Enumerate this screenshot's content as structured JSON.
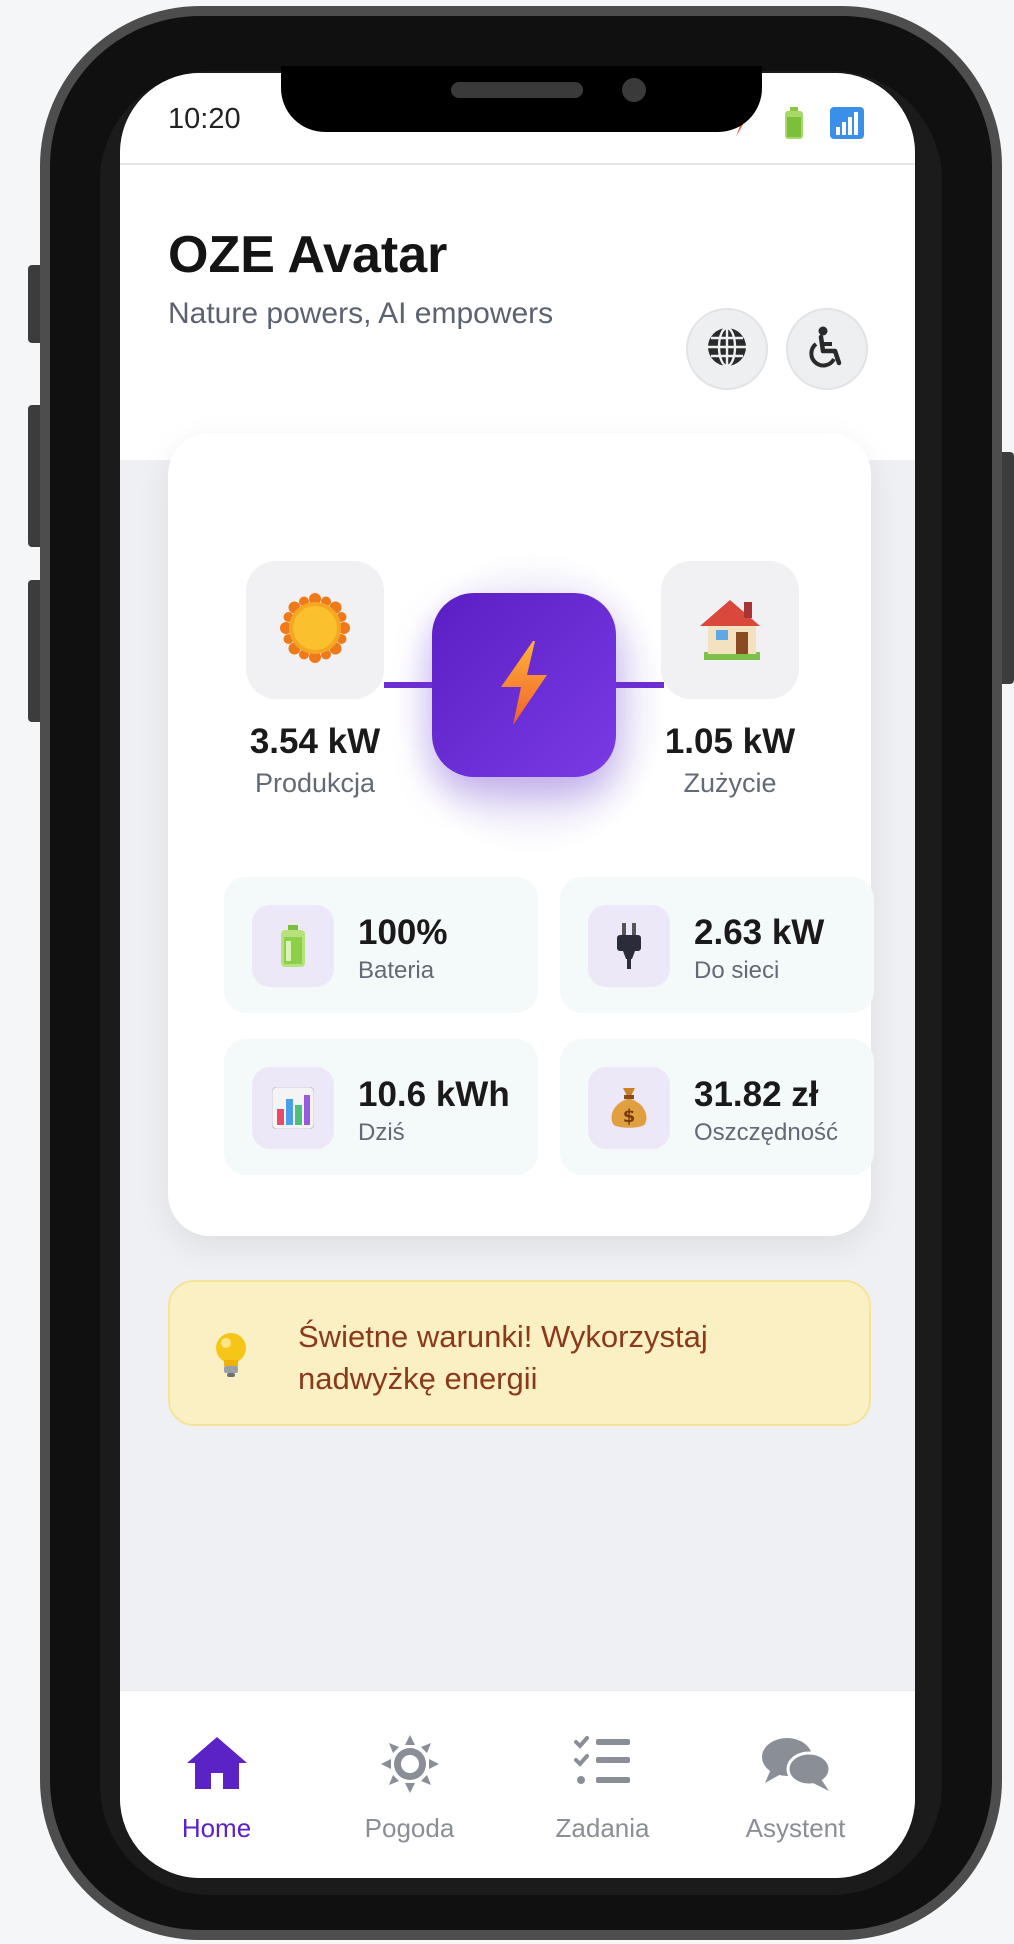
{
  "status_bar": {
    "time": "10:20"
  },
  "header": {
    "title": "OZE Avatar",
    "subtitle": "Nature powers, AI empowers"
  },
  "energy": {
    "production": {
      "value": "3.54 kW",
      "label": "Produkcja"
    },
    "consumption": {
      "value": "1.05 kW",
      "label": "Zużycie"
    },
    "stats": [
      {
        "value": "100%",
        "label": "Bateria",
        "icon": "battery-icon"
      },
      {
        "value": "2.63 kW",
        "label": "Do sieci",
        "icon": "plug-icon"
      },
      {
        "value": "10.6 kWh",
        "label": "Dziś",
        "icon": "bar-chart-icon"
      },
      {
        "value": "31.82 zł",
        "label": "Oszczędność",
        "icon": "money-bag-icon"
      }
    ]
  },
  "tip": {
    "text": "Świetne warunki! Wykorzystaj nadwyżkę energii",
    "icon": "lightbulb-icon"
  },
  "nav": [
    {
      "label": "Home",
      "icon": "home-icon",
      "active": true
    },
    {
      "label": "Pogoda",
      "icon": "sun-icon",
      "active": false
    },
    {
      "label": "Zadania",
      "icon": "tasks-icon",
      "active": false
    },
    {
      "label": "Asystent",
      "icon": "chat-icon",
      "active": false
    }
  ],
  "colors": {
    "accent": "#5b22c6",
    "tip_bg": "#fbf0c4",
    "tip_text": "#8a3a1a"
  }
}
